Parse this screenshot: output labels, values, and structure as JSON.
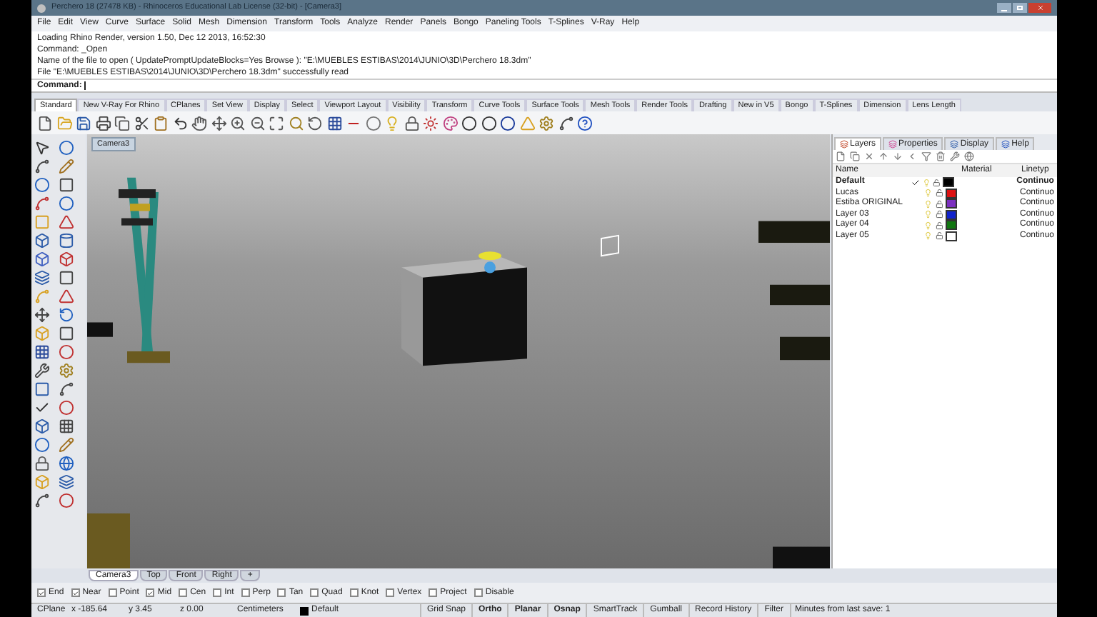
{
  "window": {
    "title": "Perchero 18 (27478 KB) - Rhinoceros Educational Lab License (32-bit) - [Camera3]"
  },
  "menu": [
    "File",
    "Edit",
    "View",
    "Curve",
    "Surface",
    "Solid",
    "Mesh",
    "Dimension",
    "Transform",
    "Tools",
    "Analyze",
    "Render",
    "Panels",
    "Bongo",
    "Paneling Tools",
    "T-Splines",
    "V-Ray",
    "Help"
  ],
  "command_history": [
    "Loading Rhino Render, version 1.50, Dec 12 2013, 16:52:30",
    "Command: _Open",
    "Name of the file to open ( UpdatePromptUpdateBlocks=Yes  Browse ): \"E:\\MUEBLES ESTIBAS\\2014\\JUNIO\\3D\\Perchero 18.3dm\"",
    "File \"E:\\MUEBLES ESTIBAS\\2014\\JUNIO\\3D\\Perchero 18.3dm\" successfully read"
  ],
  "command_prompt": "Command:",
  "toolbar_tabs": [
    {
      "label": "Standard",
      "selected": true
    },
    {
      "label": "New V-Ray For Rhino",
      "selected": false
    },
    {
      "label": "CPlanes",
      "selected": false
    },
    {
      "label": "Set View",
      "selected": false
    },
    {
      "label": "Display",
      "selected": false
    },
    {
      "label": "Select",
      "selected": false
    },
    {
      "label": "Viewport Layout",
      "selected": false
    },
    {
      "label": "Visibility",
      "selected": false
    },
    {
      "label": "Transform",
      "selected": false
    },
    {
      "label": "Curve Tools",
      "selected": false
    },
    {
      "label": "Surface Tools",
      "selected": false
    },
    {
      "label": "Mesh Tools",
      "selected": false
    },
    {
      "label": "Render Tools",
      "selected": false
    },
    {
      "label": "Drafting",
      "selected": false
    },
    {
      "label": "New in V5",
      "selected": false
    },
    {
      "label": "Bongo",
      "selected": false
    },
    {
      "label": "T-Splines",
      "selected": false
    },
    {
      "label": "Dimension",
      "selected": false
    },
    {
      "label": "Lens Length",
      "selected": false
    }
  ],
  "viewport": {
    "title": "Camera3"
  },
  "panel": {
    "tabs": [
      {
        "label": "Layers",
        "selected": true
      },
      {
        "label": "Properties",
        "selected": false
      },
      {
        "label": "Display",
        "selected": false
      },
      {
        "label": "Help",
        "selected": false
      }
    ],
    "columns": [
      "Name",
      "Material",
      "Linetyp"
    ],
    "layers": [
      {
        "name": "Default",
        "current": true,
        "color": "#000000",
        "linetype": "Continuo"
      },
      {
        "name": "Lucas",
        "current": false,
        "color": "#dd1111",
        "linetype": "Continuo"
      },
      {
        "name": "Estiba ORIGINAL",
        "current": false,
        "color": "#7b2fbf",
        "linetype": "Continuo"
      },
      {
        "name": "Layer 03",
        "current": false,
        "color": "#1122cc",
        "linetype": "Continuo"
      },
      {
        "name": "Layer 04",
        "current": false,
        "color": "#117711",
        "linetype": "Continuo"
      },
      {
        "name": "Layer 05",
        "current": false,
        "color": "#ffffff",
        "linetype": "Continuo"
      }
    ]
  },
  "viewport_tabs": [
    {
      "label": "Camera3",
      "selected": true
    },
    {
      "label": "Top",
      "selected": false
    },
    {
      "label": "Front",
      "selected": false
    },
    {
      "label": "Right",
      "selected": false
    },
    {
      "label": "+",
      "selected": false
    }
  ],
  "osnaps": [
    {
      "label": "End",
      "checked": true
    },
    {
      "label": "Near",
      "checked": true
    },
    {
      "label": "Point",
      "checked": false
    },
    {
      "label": "Mid",
      "checked": true
    },
    {
      "label": "Cen",
      "checked": false
    },
    {
      "label": "Int",
      "checked": false
    },
    {
      "label": "Perp",
      "checked": false
    },
    {
      "label": "Tan",
      "checked": false
    },
    {
      "label": "Quad",
      "checked": false
    },
    {
      "label": "Knot",
      "checked": false
    },
    {
      "label": "Vertex",
      "checked": false
    },
    {
      "label": "Project",
      "checked": false
    },
    {
      "label": "Disable",
      "checked": false
    }
  ],
  "status_bar": {
    "cplane": "CPlane",
    "x": "x -185.64",
    "y": "y 3.45",
    "z": "z 0.00",
    "units": "Centimeters",
    "layer": {
      "name": "Default",
      "color": "#000000"
    },
    "toggles": [
      {
        "label": "Grid Snap",
        "on": false
      },
      {
        "label": "Ortho",
        "on": true
      },
      {
        "label": "Planar",
        "on": true
      },
      {
        "label": "Osnap",
        "on": true
      },
      {
        "label": "SmartTrack",
        "on": false
      },
      {
        "label": "Gumball",
        "on": false
      },
      {
        "label": "Record History",
        "on": false
      },
      {
        "label": "Filter",
        "on": false
      }
    ],
    "message": "Minutes from last save: 1"
  }
}
